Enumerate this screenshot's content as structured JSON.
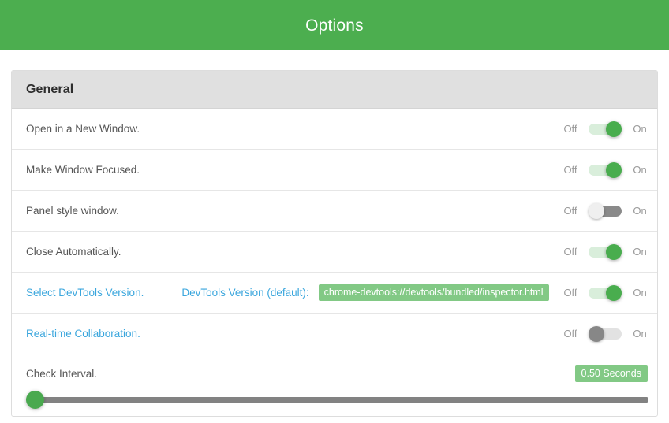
{
  "header": {
    "title": "Options"
  },
  "section": {
    "title": "General",
    "toggle_labels": {
      "off": "Off",
      "on": "On"
    },
    "rows": [
      {
        "label": "Open in a New Window.",
        "state": "on"
      },
      {
        "label": "Make Window Focused.",
        "state": "on"
      },
      {
        "label": "Panel style window.",
        "state": "off"
      },
      {
        "label": "Close Automatically.",
        "state": "on"
      }
    ],
    "devtools_row": {
      "label": "Select DevTools Version.",
      "sublabel": "DevTools Version (default):",
      "value": "chrome-devtools://devtools/bundled/inspector.html",
      "state": "on"
    },
    "collaboration_row": {
      "label": "Real-time Collaboration.",
      "state": "muted"
    },
    "interval_row": {
      "label": "Check Interval.",
      "value": "0.50 Seconds",
      "slider_percent": 0
    }
  },
  "colors": {
    "brand_green": "#4cae4f",
    "toggle_on_knob": "#49ad4e",
    "badge_green": "#82c985",
    "link_blue": "#3aa6dd",
    "section_header_bg": "#e0e0e0"
  }
}
